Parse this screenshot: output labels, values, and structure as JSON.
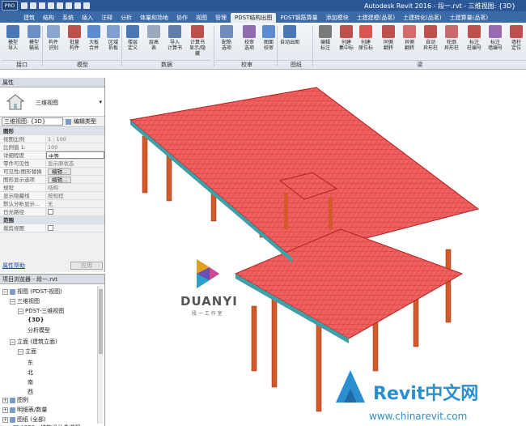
{
  "titlebar": {
    "app_button": "PRO",
    "title": "Autodesk Revit 2016 -   段一.rvt - 三维视图: {3D}"
  },
  "tabs": [
    {
      "label": "建筑"
    },
    {
      "label": "结构"
    },
    {
      "label": "系统"
    },
    {
      "label": "插入"
    },
    {
      "label": "注释"
    },
    {
      "label": "分析"
    },
    {
      "label": "体量和场地"
    },
    {
      "label": "协作"
    },
    {
      "label": "视图"
    },
    {
      "label": "管理"
    },
    {
      "label": "PDST结构出图",
      "active": true
    },
    {
      "label": "PDST钢筋算量"
    },
    {
      "label": "添加模块"
    },
    {
      "label": "土建建模(品茗)"
    },
    {
      "label": "土建转化(品茗)"
    },
    {
      "label": "土建算量(品茗)"
    }
  ],
  "ribbon": {
    "buttons": [
      {
        "label": "模型\n导入",
        "color": "#4a78b5"
      },
      {
        "label": "模型\n输出",
        "color": "#6b8fc2"
      },
      {
        "label": "构件\n识别",
        "color": "#8aa6cf"
      },
      {
        "label": "批量\n构件",
        "color": "#c0504d"
      },
      {
        "label": "大板\n合并",
        "color": "#5b8bd0"
      },
      {
        "label": "区域\n拆板",
        "color": "#7f9fd0"
      },
      {
        "label": "楼层\n定义",
        "color": "#4a78b5"
      },
      {
        "label": "层高\n表",
        "color": "#9aa9bd"
      },
      {
        "label": "导入\n计算书",
        "color": "#5f7fa8"
      },
      {
        "label": "计算书\n显示/隐藏",
        "color": "#c0504d"
      },
      {
        "label": "配筋\n选项",
        "color": "#6f8db9"
      },
      {
        "label": "校审\n选项",
        "color": "#8f6bb0"
      },
      {
        "label": "图面\n校审",
        "color": "#5b8bd0"
      },
      {
        "label": "自动出图",
        "color": "#4a78b5"
      },
      {
        "label": "编辑\n标注",
        "color": "#7a7a7a"
      },
      {
        "label": "创建\n集中标",
        "color": "#c0504d"
      },
      {
        "label": "创建\n原位标",
        "color": "#d9534f"
      },
      {
        "label": "同側\n翻转",
        "color": "#c0504d"
      },
      {
        "label": "异側\n翻转",
        "color": "#d46a6a"
      },
      {
        "label": "自动\n异形柱",
        "color": "#c0504d"
      },
      {
        "label": "轮廓\n异形柱",
        "color": "#c96a6a"
      },
      {
        "label": "标注\n柱编号",
        "color": "#c0504d"
      },
      {
        "label": "标注\n墙编号",
        "color": "#9a6ab0"
      },
      {
        "label": "墙柱\n定位",
        "color": "#c05050"
      }
    ],
    "panels": [
      {
        "label": "接口"
      },
      {
        "label": "模型"
      },
      {
        "label": "数据"
      },
      {
        "label": "校审"
      },
      {
        "label": "图纸"
      },
      {
        "label": "梁"
      }
    ]
  },
  "properties": {
    "header": "属性",
    "type_name": "三维视图",
    "view_selector": "三维视图: {3D}",
    "edit_type": "编辑类型",
    "rows": [
      {
        "k": "图形",
        "group": true
      },
      {
        "k": "视图比例",
        "v": "1 : 100"
      },
      {
        "k": "比例值 1:",
        "v": "100"
      },
      {
        "k": "详细程度",
        "v": "中等"
      },
      {
        "k": "零件可见性",
        "v": "显示原状态"
      },
      {
        "k": "可见性/图形替换",
        "v": "编辑..."
      },
      {
        "k": "图形显示选项",
        "v": "编辑..."
      },
      {
        "k": "规程",
        "v": "结构"
      },
      {
        "k": "显示隐藏线",
        "v": "按规程"
      },
      {
        "k": "默认分析显示...",
        "v": "无"
      },
      {
        "k": "日光路径",
        "v": ""
      },
      {
        "k": "范围",
        "group": true
      },
      {
        "k": "裁剪视图",
        "v": ""
      }
    ],
    "help_link": "属性帮助",
    "apply": "应用"
  },
  "browser": {
    "header": "项目浏览器 - 段一.rvt",
    "items": [
      {
        "label": "视图 (PDST-视图)"
      },
      {
        "label": "三维视图"
      },
      {
        "label": "PDST-三维视图"
      },
      {
        "label": "{3D}"
      },
      {
        "label": "分析模型"
      },
      {
        "label": "立面 (建筑立面)"
      },
      {
        "label": "立面"
      },
      {
        "label": "东"
      },
      {
        "label": "北"
      },
      {
        "label": "南"
      },
      {
        "label": "西"
      },
      {
        "label": "图例"
      },
      {
        "label": "明细表/数量"
      },
      {
        "label": "图纸 (全部)"
      },
      {
        "label": "A330 - 结构设计总说明"
      }
    ]
  },
  "watermarks": {
    "duanyi_text": "DUANYI",
    "duanyi_sub": "段 一 工 作 室",
    "revit_text": "Revit中文网",
    "revit_url": "www.chinarevit.com"
  }
}
